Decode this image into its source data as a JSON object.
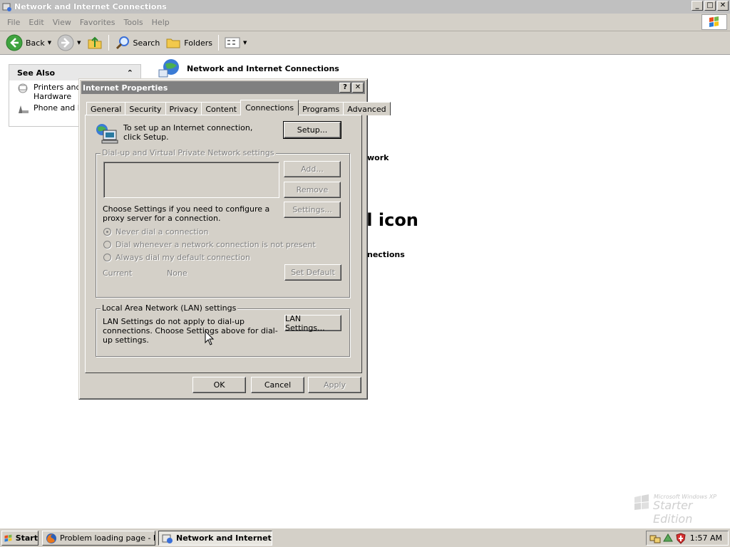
{
  "window": {
    "title": "Network and Internet Connections",
    "controls": {
      "minimize": "_",
      "maximize": "□",
      "close": "✕"
    }
  },
  "menu": [
    "File",
    "Edit",
    "View",
    "Favorites",
    "Tools",
    "Help"
  ],
  "toolbar": {
    "back": "Back",
    "search": "Search",
    "folders": "Folders"
  },
  "see_also": {
    "title": "See Also",
    "items": [
      {
        "label": "Printers and Other",
        "label2": "Hardware",
        "icon": "printer-icon"
      },
      {
        "label": "Phone and Modem Options",
        "icon": "phone-icon"
      }
    ]
  },
  "content": {
    "header": "Network and Internet Connections",
    "frag_network": "work",
    "frag_icon": "el icon",
    "frag_connections": "nections"
  },
  "brand": {
    "small": "Microsoft Windows XP",
    "big": "Starter Edition"
  },
  "dialog": {
    "title": "Internet Properties",
    "help": "?",
    "close": "✕",
    "tabs": [
      "General",
      "Security",
      "Privacy",
      "Content",
      "Connections",
      "Programs",
      "Advanced"
    ],
    "active_tab": "Connections",
    "setup_text": "To set up an Internet connection, click Setup.",
    "setup_button": "Setup...",
    "dialup_group": "Dial-up and Virtual Private Network settings",
    "add_button": "Add...",
    "remove_button": "Remove",
    "settings_text": "Choose Settings if you need to configure a proxy server for a connection.",
    "settings_button": "Settings...",
    "radios": [
      {
        "label": "Never dial a connection",
        "checked": true
      },
      {
        "label": "Dial whenever a network connection is not present",
        "checked": false
      },
      {
        "label": "Always dial my default connection",
        "checked": false
      }
    ],
    "current_label": "Current",
    "current_value": "None",
    "set_default_button": "Set Default",
    "lan_group": "Local Area Network (LAN) settings",
    "lan_text": "LAN Settings do not apply to dial-up connections. Choose Settings above for dial-up settings.",
    "lan_button": "LAN Settings...",
    "ok": "OK",
    "cancel": "Cancel",
    "apply": "Apply"
  },
  "taskbar": {
    "start": "Start",
    "tasks": [
      {
        "label": "Problem loading page - M...",
        "active": false
      },
      {
        "label": "Network and Internet...",
        "active": true
      }
    ],
    "clock": "1:57 AM"
  }
}
